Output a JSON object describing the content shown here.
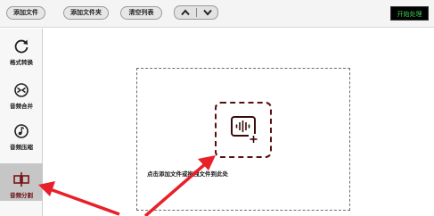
{
  "toolbar": {
    "add_file": "添加文件",
    "add_folder": "添加文件夹",
    "clear_list": "清空列表",
    "start": "开始处理"
  },
  "sidebar": {
    "items": [
      {
        "label": "格式转换",
        "icon": "refresh-icon"
      },
      {
        "label": "音频合并",
        "icon": "merge-icon"
      },
      {
        "label": "音频压缩",
        "icon": "compress-icon"
      },
      {
        "label": "音频分割",
        "icon": "split-icon"
      }
    ]
  },
  "main": {
    "drop_text": "点击添加文件或拖拽文件到此处"
  },
  "colors": {
    "accent": "#5a0f0f",
    "arrow": "#e8202a",
    "start_text": "#3ad15a"
  }
}
